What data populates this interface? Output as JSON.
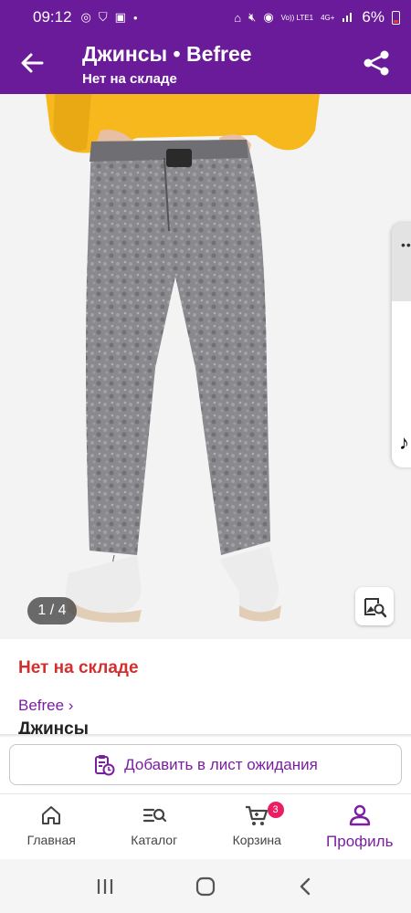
{
  "status_bar": {
    "time": "09:12",
    "signal_text": "Vo)) LTE1",
    "net_type": "4G+",
    "battery_pct": "6%"
  },
  "app_bar": {
    "title": "Джинсы • Befree",
    "subtitle": "Нет на складе"
  },
  "gallery": {
    "counter": "1 / 4",
    "current": 1,
    "total": 4
  },
  "product": {
    "stock_status": "Нет на складе",
    "brand_link": "Befree ›",
    "name": "Джинсы"
  },
  "actions": {
    "waitlist_label": "Добавить в лист ожидания"
  },
  "bottom_nav": {
    "items": [
      {
        "label": "Главная",
        "icon": "home-icon"
      },
      {
        "label": "Каталог",
        "icon": "catalog-search-icon"
      },
      {
        "label": "Корзина",
        "icon": "cart-icon",
        "badge": "3"
      },
      {
        "label": "Профиль",
        "icon": "profile-icon",
        "active": true
      }
    ]
  },
  "colors": {
    "brand_purple": "#6a1b9a",
    "accent_purple": "#7b1fa2",
    "stock_red": "#d32f2f",
    "badge_pink": "#e91e63"
  }
}
